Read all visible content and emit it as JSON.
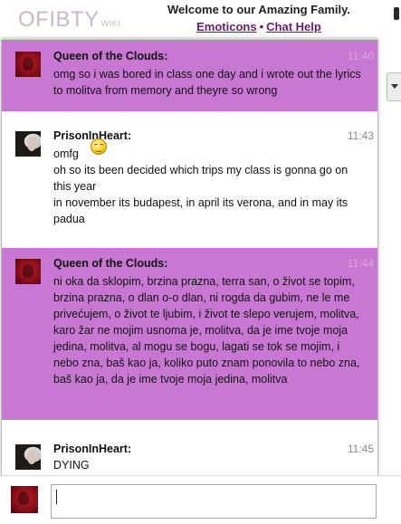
{
  "header": {
    "logo": "OFIBTY",
    "logo_suffix": "WIKI",
    "welcome": "Welcome to our Amazing Family.",
    "link_emoticons": "Emoticons",
    "separator": "•",
    "link_chat_help": "Chat Help"
  },
  "messages": [
    {
      "name": "Queen of the Clouds",
      "suffix": ":",
      "time": "11:40",
      "lines": [
        "omg so i was bored in class one day and i wrote out the lyrics to molitva from memory and theyre so wrong"
      ]
    },
    {
      "name": "PrisonInHeart",
      "suffix": ":",
      "time": "11:43",
      "lines": [
        "omfg",
        "oh so its been decided which trips my class is gonna go on this year",
        "in november its budapest, in april its verona, and in may its padua"
      ]
    },
    {
      "name": "Queen of the Clouds",
      "suffix": ":",
      "time": "11:44",
      "lines": [
        "ni oka da sklopim, brzina prazna, terra san, o život se topim, brzina prazna, o dlan o-o dlan, ni rogda da gubim, ne le me privećujem, o život te ljubim, i život te slepo verujem, molitva, karo žar ne mojim usnoma je, molitva, da je ime tvoje moja jedina, molitva, al mogu se bogu, lagati se tok se mojim, i nebo zna, baš kao ja, koliko puto znam ponovila to nebo zna, baš kao ja, da je ime tvoje moja jedina, molitva"
      ]
    },
    {
      "name": "PrisonInHeart",
      "suffix": ":",
      "time": "11:45",
      "lines": [
        "DYING"
      ]
    }
  ],
  "icons": {
    "emoticon": "laughing-emoticon-icon",
    "dropdown": "chevron-down-icon"
  },
  "colors": {
    "own_message_bg": "#c878d2",
    "link": "#6a1b6a",
    "logo": "#c9b8c9"
  }
}
